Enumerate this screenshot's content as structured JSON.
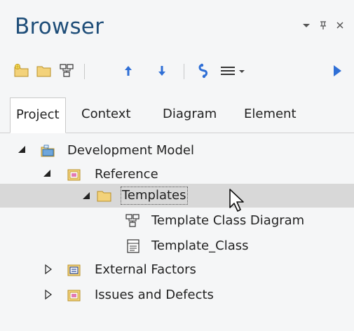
{
  "window": {
    "title": "Browser",
    "controls": {
      "dropdown": "▾",
      "pin": "⊓",
      "close": "×"
    }
  },
  "toolbar": {
    "buttons": [
      "new-package-icon",
      "folder-icon",
      "diagram-icon",
      "move-up-icon",
      "move-down-icon",
      "locate-icon",
      "menu-icon",
      "run-icon"
    ]
  },
  "tabs": [
    {
      "label": "Project",
      "active": true
    },
    {
      "label": "Context",
      "active": false
    },
    {
      "label": "Diagram",
      "active": false
    },
    {
      "label": "Element",
      "active": false
    }
  ],
  "tree": {
    "items": [
      {
        "label": "Development Model",
        "icon": "model-icon",
        "expander": "expanded",
        "selected": false
      },
      {
        "label": "Reference",
        "icon": "view-icon",
        "expander": "expanded",
        "selected": false
      },
      {
        "label": "Templates",
        "icon": "package-folder-icon",
        "expander": "expanded",
        "selected": true
      },
      {
        "label": "Template Class Diagram",
        "icon": "class-diagram-icon",
        "expander": "none",
        "selected": false
      },
      {
        "label": "Template_Class",
        "icon": "class-icon",
        "expander": "none",
        "selected": false
      },
      {
        "label": "External Factors",
        "icon": "view-blue-icon",
        "expander": "collapsed",
        "selected": false
      },
      {
        "label": "Issues and Defects",
        "icon": "view-icon",
        "expander": "collapsed",
        "selected": false
      }
    ]
  },
  "colors": {
    "title": "#1f4e79",
    "accent_blue": "#2f6fd6",
    "selection": "#d8d8d8"
  }
}
